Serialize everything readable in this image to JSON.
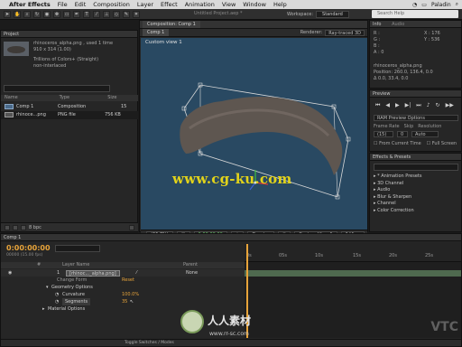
{
  "menubar": {
    "app": "After Effects",
    "items": [
      "File",
      "Edit",
      "Composition",
      "Layer",
      "Effect",
      "Animation",
      "View",
      "Window",
      "Help"
    ],
    "user": "Paladin"
  },
  "toolbar": {
    "doc_title": "Untitled Project.aep *",
    "workspace_label": "Workspace:",
    "workspace_value": "Standard",
    "search_placeholder": "Search Help"
  },
  "project": {
    "tab": "Project",
    "item_name": "rhinoceros_alpha.png",
    "item_used": "used 1 time",
    "dims": "910 x 314 (1.00)",
    "colors": "Trillions of Colors+ (Straight)",
    "interlace": "non-interlaced",
    "columns": [
      "Name",
      "Type",
      "Size"
    ],
    "rows": [
      {
        "name": "Comp 1",
        "type": "Composition",
        "size": "",
        "extra": "15"
      },
      {
        "name": "rhinoce...png",
        "type": "PNG file",
        "size": "756 KB",
        "extra": ""
      }
    ],
    "bpc": "8 bpc"
  },
  "composition": {
    "tab_label": "Composition: Comp 1",
    "comp_name": "Comp 1",
    "renderer_label": "Renderer:",
    "renderer_value": "Ray-traced 3D",
    "view_label": "Custom view 1",
    "watermark": "www.cg-ku.com",
    "foot": {
      "zoom": "(66.7%)",
      "time": "0;00;00;00",
      "quality": "Quarter",
      "view": "Custom View 1",
      "views": "1 View"
    }
  },
  "info": {
    "tab_info": "Info",
    "tab_audio": "Audio",
    "channels": [
      "R :",
      "G :",
      "B :",
      "A : 0"
    ],
    "xy": [
      "X : 176",
      "Y : 536"
    ],
    "layer_name": "rhinoceros_alpha.png",
    "position": "Position: 260.0, 136.4, 0.0",
    "delta": "Δ 0.0, 33.4, 0.0"
  },
  "preview": {
    "tab": "Preview",
    "ram_options": "RAM Preview Options",
    "frame_rate_label": "Frame Rate",
    "skip_label": "Skip",
    "resolution_label": "Resolution",
    "frame_rate": "(15)",
    "skip": "0",
    "resolution": "Auto",
    "from_current": "From Current Time",
    "full_screen": "Full Screen"
  },
  "effects": {
    "tab": "Effects & Presets",
    "items": [
      "* Animation Presets",
      "3D Channel",
      "Audio",
      "Blur & Sharpen",
      "Channel",
      "Color Correction"
    ]
  },
  "timeline": {
    "tab": "Comp 1",
    "timecode": "0:00:00:00",
    "fps": "00000 (15.00 fps)",
    "columns": [
      "#",
      "Layer Name",
      "Parent"
    ],
    "layer_index": "1",
    "layer_name": "[rhinoc..._alpha.png]",
    "parent": "None",
    "props": {
      "changes_label": "Change Form",
      "reset": "Reset",
      "geometry": "Geometry Options",
      "curvature_label": "Curvature",
      "curvature_value": "100.0%",
      "segments_label": "Segments",
      "segments_value": "35",
      "material": "Material Options"
    },
    "ticks": [
      "0s",
      "05s",
      "10s",
      "15s",
      "20s",
      "25s"
    ],
    "toggle_label": "Toggle Switches / Modes"
  },
  "overlay": {
    "vtc": "VTC",
    "site_name": "人人素材",
    "site_url": "www.rr-sc.com"
  }
}
